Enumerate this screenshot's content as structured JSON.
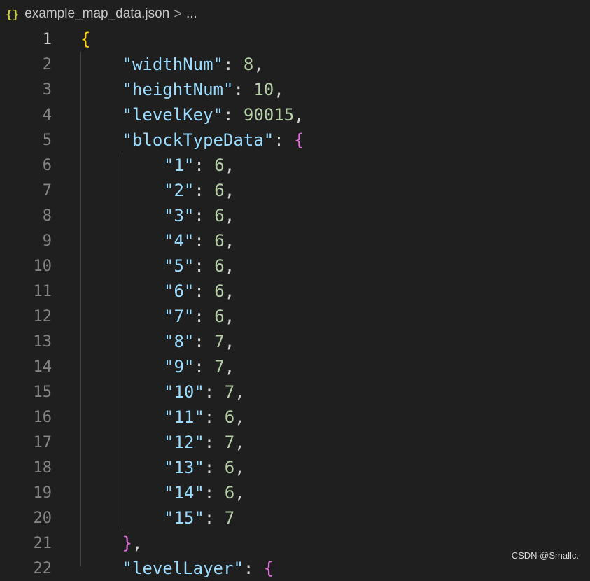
{
  "breadcrumb": {
    "icon": "json-braces-icon",
    "icon_text": "{}",
    "file": "example_map_data.json",
    "separator": ">",
    "ellipsis": "..."
  },
  "lines": [
    {
      "n": "1",
      "open": "{"
    },
    {
      "n": "2",
      "key": "\"widthNum\"",
      "value": "8",
      "comma": ","
    },
    {
      "n": "3",
      "key": "\"heightNum\"",
      "value": "10",
      "comma": ","
    },
    {
      "n": "4",
      "key": "\"levelKey\"",
      "value": "90015",
      "comma": ","
    },
    {
      "n": "5",
      "key": "\"blockTypeData\"",
      "open": "{"
    },
    {
      "n": "6",
      "key": "\"1\"",
      "value": "6",
      "comma": ","
    },
    {
      "n": "7",
      "key": "\"2\"",
      "value": "6",
      "comma": ","
    },
    {
      "n": "8",
      "key": "\"3\"",
      "value": "6",
      "comma": ","
    },
    {
      "n": "9",
      "key": "\"4\"",
      "value": "6",
      "comma": ","
    },
    {
      "n": "10",
      "key": "\"5\"",
      "value": "6",
      "comma": ","
    },
    {
      "n": "11",
      "key": "\"6\"",
      "value": "6",
      "comma": ","
    },
    {
      "n": "12",
      "key": "\"7\"",
      "value": "6",
      "comma": ","
    },
    {
      "n": "13",
      "key": "\"8\"",
      "value": "7",
      "comma": ","
    },
    {
      "n": "14",
      "key": "\"9\"",
      "value": "7",
      "comma": ","
    },
    {
      "n": "15",
      "key": "\"10\"",
      "value": "7",
      "comma": ","
    },
    {
      "n": "16",
      "key": "\"11\"",
      "value": "6",
      "comma": ","
    },
    {
      "n": "17",
      "key": "\"12\"",
      "value": "7",
      "comma": ","
    },
    {
      "n": "18",
      "key": "\"13\"",
      "value": "6",
      "comma": ","
    },
    {
      "n": "19",
      "key": "\"14\"",
      "value": "6",
      "comma": ","
    },
    {
      "n": "20",
      "key": "\"15\"",
      "value": "7"
    },
    {
      "n": "21",
      "close": "}",
      "comma": ","
    },
    {
      "n": "22",
      "key": "\"levelLayer\"",
      "open": "{"
    }
  ],
  "colors": {
    "background": "#1f1f1f",
    "key": "#9cdcfe",
    "number": "#b5cea8",
    "bracket_level1": "#ffd700",
    "bracket_level2": "#da70d6",
    "line_number": "#858585"
  },
  "watermark": "CSDN @Smallc."
}
